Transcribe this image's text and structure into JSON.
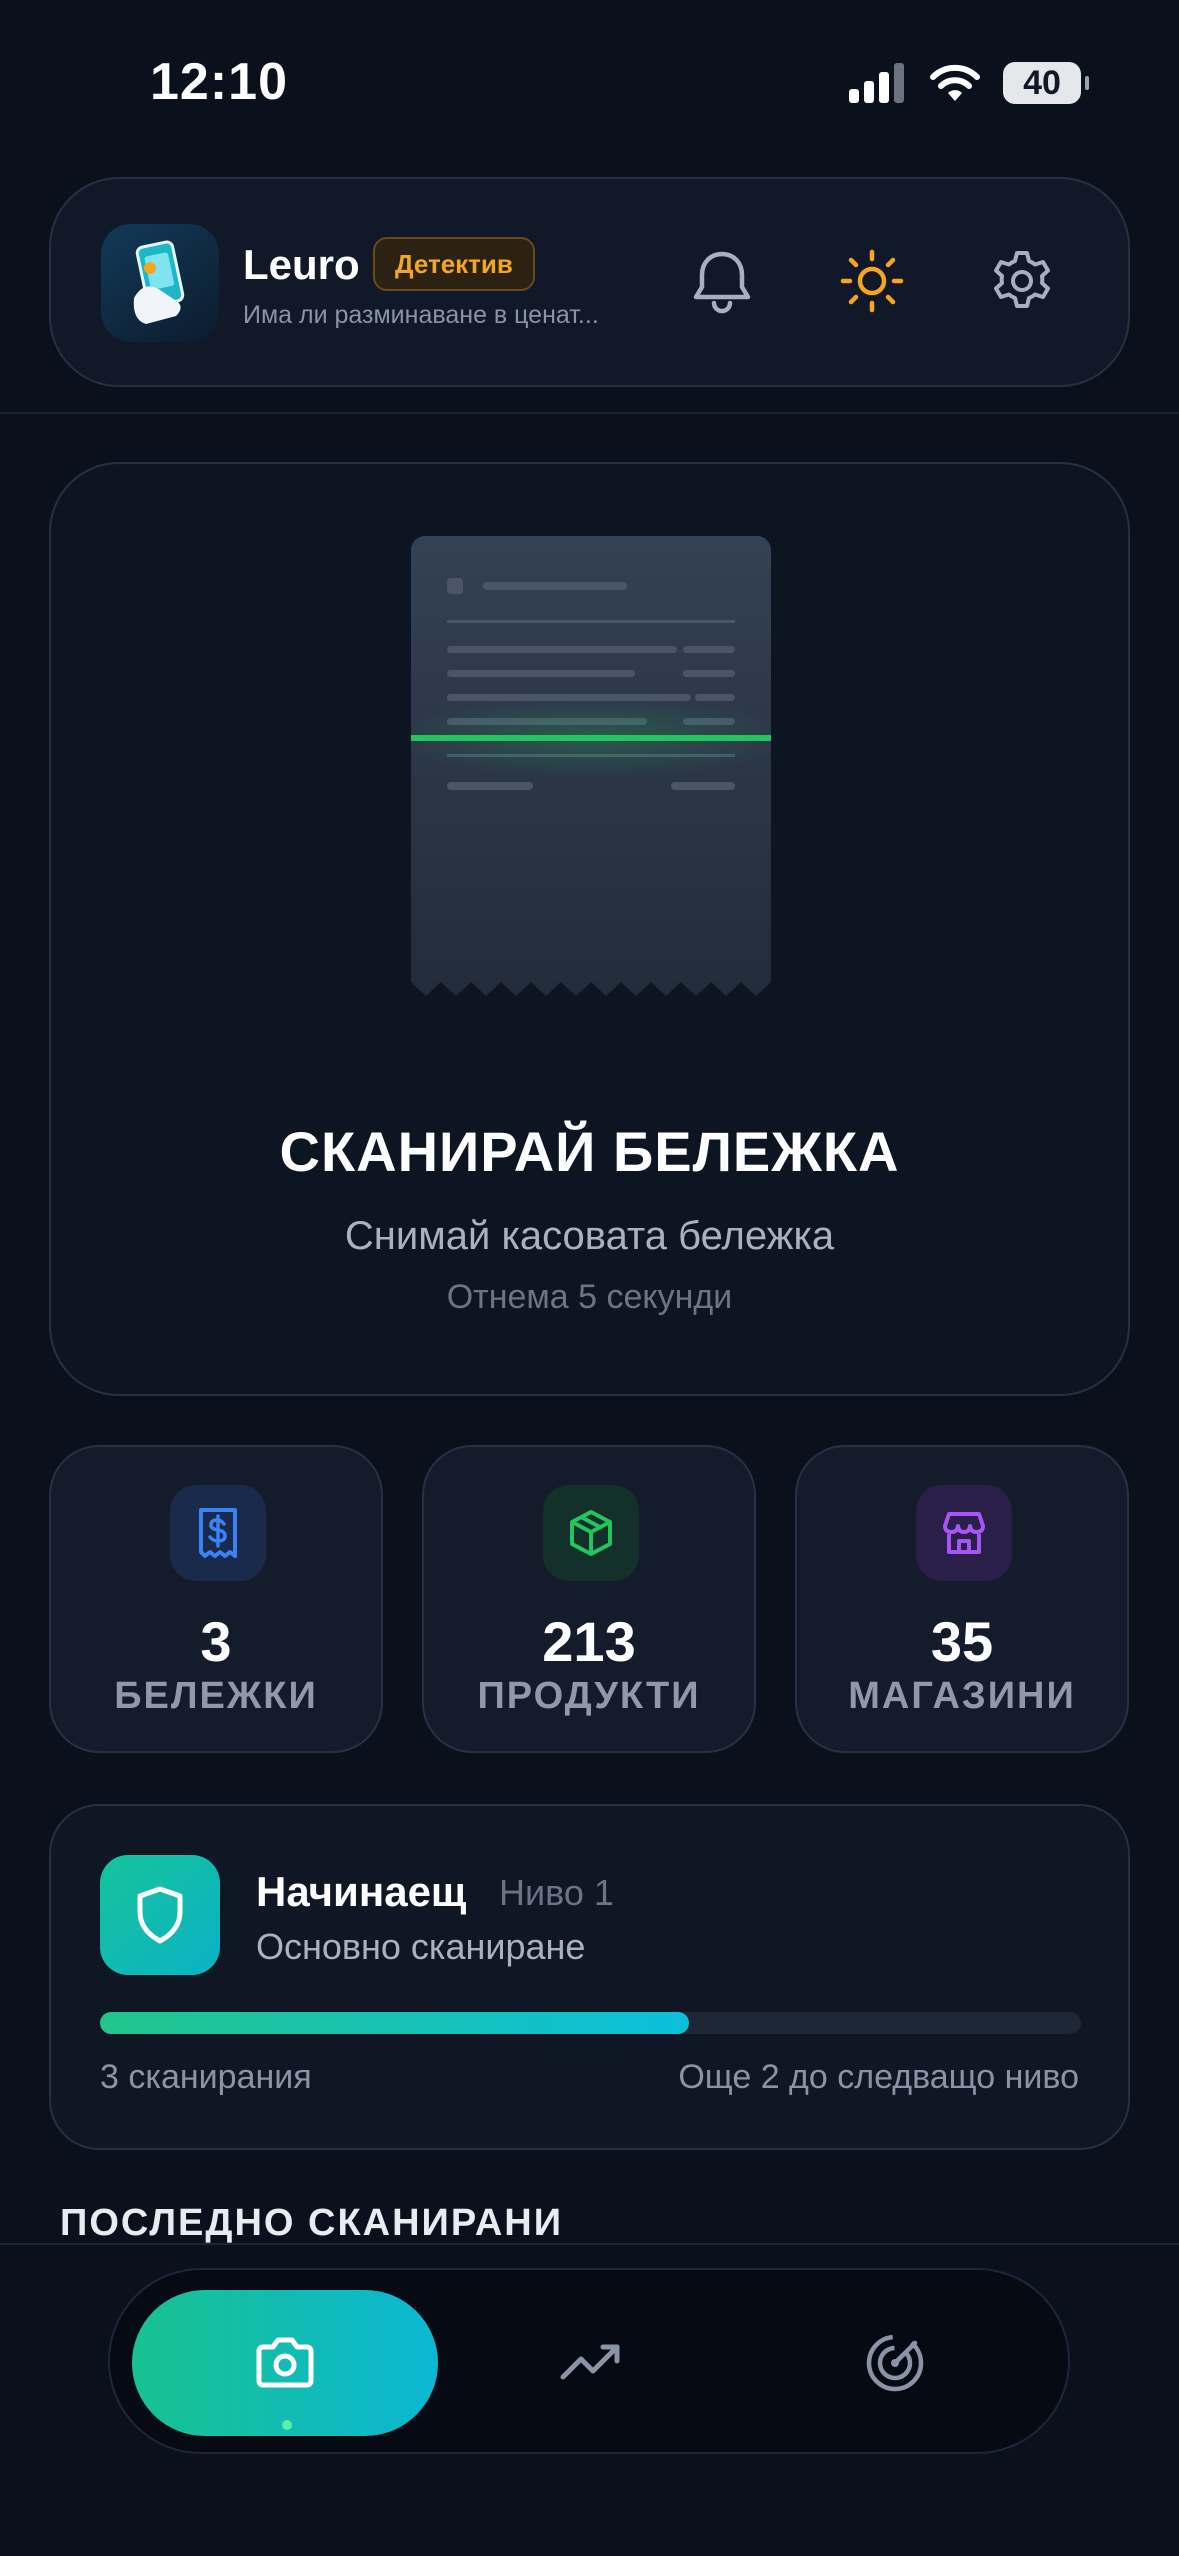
{
  "status_bar": {
    "time": "12:10",
    "battery": "40"
  },
  "header": {
    "app_name": "Leuro",
    "badge": "Детектив",
    "subtitle": "Има ли разминаване в ценат...",
    "icons": [
      "bell-icon",
      "sun-icon",
      "gear-icon"
    ],
    "accent_color": "#f5a524"
  },
  "scan_card": {
    "title": "СКАНИРАЙ БЕЛЕЖКА",
    "subtitle": "Снимай касовата бележка",
    "note": "Отнема 5 секунди",
    "scan_line_color": "#22c55e"
  },
  "stats": [
    {
      "value": "3",
      "label": "БЕЛЕЖКИ",
      "icon": "receipt-icon",
      "color": "#3b82f6"
    },
    {
      "value": "213",
      "label": "ПРОДУКТИ",
      "icon": "box-icon",
      "color": "#22c55e"
    },
    {
      "value": "35",
      "label": "МАГАЗИНИ",
      "icon": "store-icon",
      "color": "#a855f7"
    }
  ],
  "level": {
    "title": "Начинаещ",
    "level_text": "Ниво 1",
    "description": "Основно сканиране",
    "progress_fraction": 0.6,
    "left_text": "3 сканирания",
    "right_text": "Още 2 до следващо ниво"
  },
  "recent": {
    "title": "ПОСЛЕДНО СКАНИРАНИ"
  },
  "nav": {
    "items": [
      "camera-icon",
      "trending-up-icon",
      "radar-icon"
    ],
    "active_index": 0
  }
}
